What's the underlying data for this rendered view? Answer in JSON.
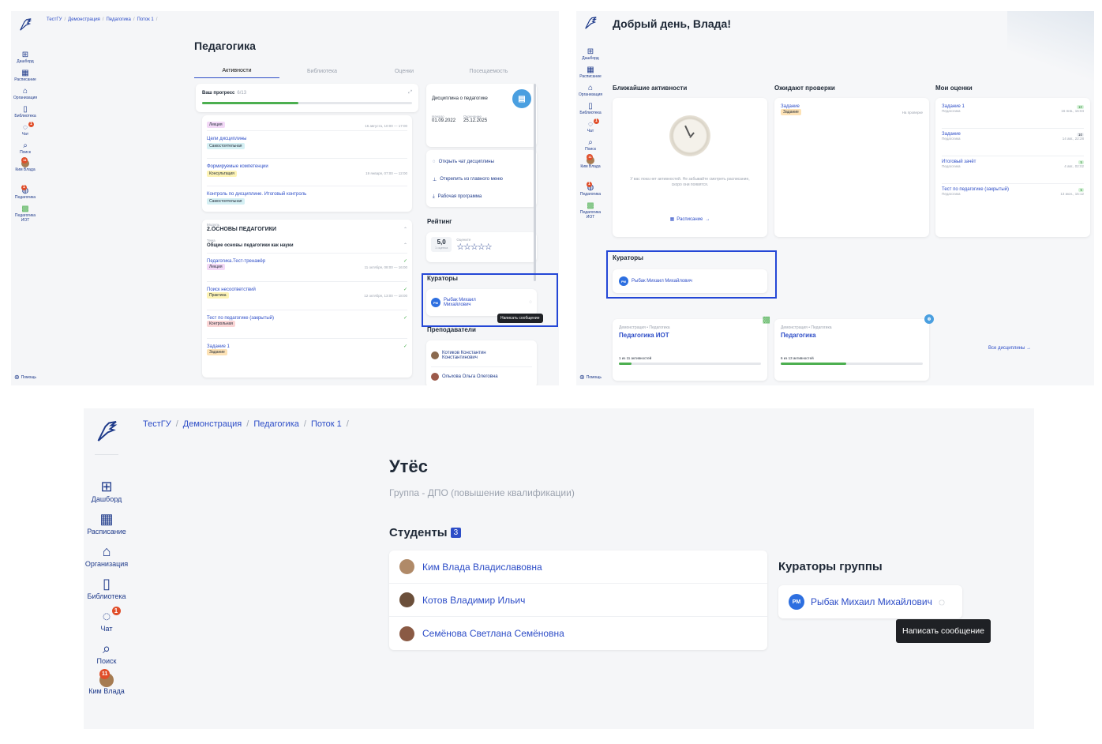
{
  "sidebar": {
    "items": [
      {
        "label": "Дашборд"
      },
      {
        "label": "Расписание"
      },
      {
        "label": "Организация"
      },
      {
        "label": "Библиотека"
      },
      {
        "label": "Чат",
        "badge": "1"
      },
      {
        "label": "Поиск"
      },
      {
        "label": "Ким Влада",
        "badge": "11"
      }
    ],
    "extra": [
      {
        "label": "Педагогика",
        "badge": "1"
      },
      {
        "label": "Педагогика ИОТ"
      }
    ],
    "help": "Помощь"
  },
  "s1": {
    "breadcrumb": [
      "ТестГУ",
      "/",
      "Демонстрация",
      "/",
      "Педагогика",
      "/",
      "Поток 1",
      "/"
    ],
    "title": "Педагогика",
    "tabs": [
      "Активности",
      "Библиотека",
      "Оценки",
      "Посещаемость"
    ],
    "progress": {
      "label": "Ваш прогресс",
      "value": "6/13",
      "fraction": 0.46
    },
    "activities": [
      {
        "title": "",
        "tag": "Лекция",
        "tag_color": "#f3d9f7",
        "date": "16 августа, 10:00 — 17:00"
      },
      {
        "title": "Цели дисциплины",
        "tag": "Самостоятельная",
        "tag_color": "#d5f0f4",
        "date": ""
      },
      {
        "title": "Формируемые компетенции",
        "tag": "Консультация",
        "tag_color": "#fdf3b5",
        "date": "19 января, 07:00 — 12:00"
      },
      {
        "title": "Контроль по дисциплине. Итоговый контроль",
        "tag": "Самостоятельная",
        "tag_color": "#d5f0f4",
        "date": ""
      }
    ],
    "module": {
      "caption": "Модуль",
      "title": "2.ОСНОВЫ ПЕДАГОГИКИ",
      "topic_caption": "Тема",
      "topic": "Общие основы педагогики как науки"
    },
    "module_items": [
      {
        "title": "Педагогика.Тест-тренажёр",
        "tag": "Лекция",
        "tag_color": "#f3d9f7",
        "date": "11 октября, 08:00 — 16:00"
      },
      {
        "title": "Поиск несоответствий",
        "tag": "Практика",
        "tag_color": "#fdf3b5",
        "date": "12 октября, 13:00 — 18:00"
      },
      {
        "title": "Тест по педагогике (закрытый)",
        "tag": "Контрольная",
        "tag_color": "#fbd5d5",
        "date": ""
      },
      {
        "title": "Задание 1",
        "tag": "Задание",
        "tag_color": "#fde2b5",
        "date": ""
      }
    ],
    "discipline": {
      "title": "Дисциплина о педагогике",
      "start_label": "Начало",
      "start": "01.09.2022",
      "end_label": "Окончание",
      "end": "25.12.2025"
    },
    "actions": [
      "Открыть чат дисциплины",
      "Открепить из главного меню",
      "Рабочая программа"
    ],
    "rating": {
      "title": "Рейтинг",
      "value": "5,0",
      "count": "1 оценка",
      "rate_label": "Оцените",
      "stars": 0
    },
    "curators_title": "Кураторы",
    "curator": {
      "initials": "РМ",
      "name_line1": "Рыбак Михаил",
      "name_line2": "Михайлович"
    },
    "tooltip": "Написать сообщение",
    "teachers_title": "Преподаватели",
    "teachers": [
      {
        "line1": "Котиков Константин",
        "line2": "Константинович"
      },
      {
        "line1": "Ольхова Ольга Олеговна",
        "line2": ""
      }
    ]
  },
  "s2": {
    "greeting": "Добрый день, Влада!",
    "near_title": "Ближайшие активности",
    "near_empty": "У вас пока нет активностей. Не забывайте смотреть расписание, скоро они появятся.",
    "schedule_link": "Расписание",
    "await_title": "Ожидают проверки",
    "await_item": {
      "title": "Задание",
      "tag": "Задание",
      "status": "На проверке"
    },
    "grades_title": "Мои оценки",
    "grades": [
      {
        "title": "Задание 1",
        "sub": "Педагогика",
        "score": "10",
        "date": "16 янв., 16:04"
      },
      {
        "title": "Задание",
        "sub": "Педагогика",
        "score": "10",
        "date": "14 авг., 22:28"
      },
      {
        "title": "Итоговый зачёт",
        "sub": "Педагогика",
        "score": "5",
        "date": "4 авг., 02:02"
      },
      {
        "title": "Тест по педагогике (закрытый)",
        "sub": "Педагогика",
        "score": "5",
        "date": "13 июн., 15:12"
      }
    ],
    "curators_title": "Кураторы",
    "curator": {
      "initials": "РМ",
      "name": "Рыбак Михаил Михайлович"
    },
    "courses": [
      {
        "crumb": "Демонстрация • Педагогика",
        "title": "Педагогика ИОТ",
        "progress_text": "1 из 11 активностей",
        "fraction": 0.09
      },
      {
        "crumb": "Демонстрация • Педагогика",
        "title": "Педагогика",
        "progress_text": "6 из 13 активностей",
        "fraction": 0.46
      }
    ],
    "all_link": "Все дисциплины →"
  },
  "s3": {
    "breadcrumb": [
      "ТестГУ",
      "/",
      "Демонстрация",
      "/",
      "Педагогика",
      "/",
      "Поток 1",
      "/"
    ],
    "title": "Утёс",
    "subtitle": "Группа - ДПО (повышение квалификации)",
    "students_title": "Студенты",
    "students_count": "3",
    "students": [
      {
        "name": "Ким Влада Владиславовна"
      },
      {
        "name": "Котов Владимир Ильич"
      },
      {
        "name": "Семёнова Светлана Семёновна"
      }
    ],
    "curators_title": "Кураторы группы",
    "curator": {
      "initials": "РМ",
      "name": "Рыбак Михаил Михайлович"
    },
    "tooltip": "Написать сообщение"
  },
  "colors": {
    "accent": "#2d4dc7",
    "highlight": "#2447d6",
    "badge": "#e04e2a",
    "progress": "#4caf50"
  }
}
